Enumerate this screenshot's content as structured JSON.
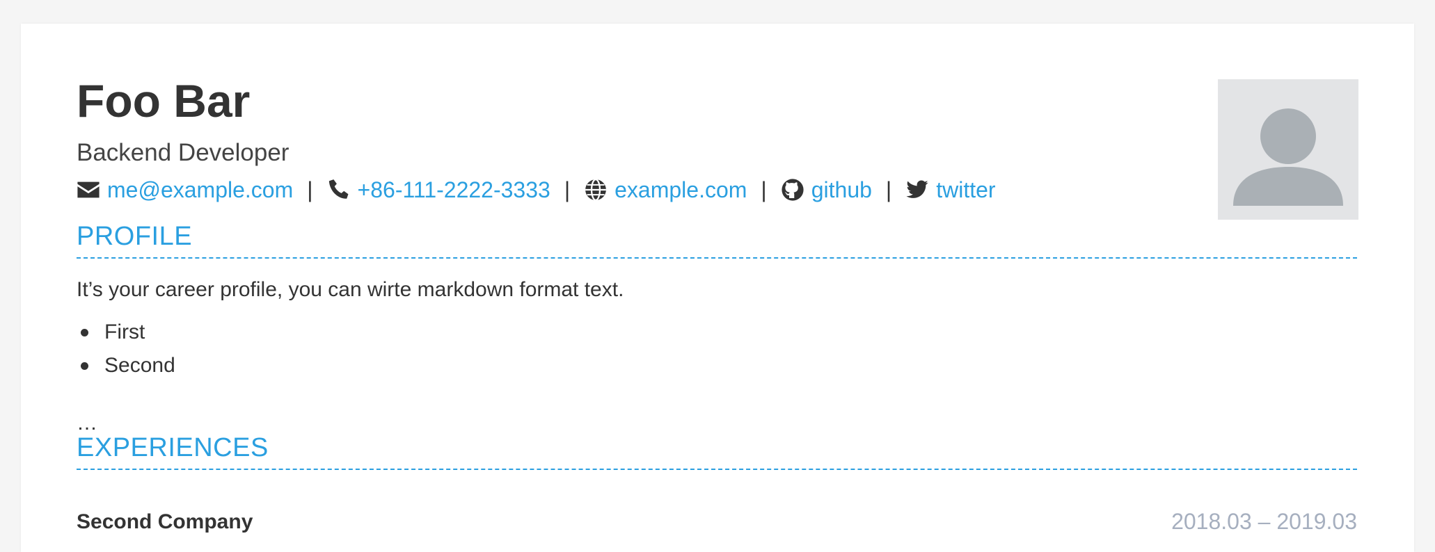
{
  "header": {
    "name": "Foo Bar",
    "role": "Backend Developer",
    "avatar_icon": "user-avatar-icon"
  },
  "contacts": {
    "email": {
      "label": "me@example.com",
      "icon": "envelope-icon"
    },
    "phone": {
      "label": "+86-111-2222-3333",
      "icon": "phone-icon"
    },
    "website": {
      "label": "example.com",
      "icon": "globe-icon"
    },
    "github": {
      "label": "github",
      "icon": "github-icon"
    },
    "twitter": {
      "label": "twitter",
      "icon": "twitter-icon"
    },
    "separator": "|"
  },
  "profile": {
    "title": "PROFILE",
    "text": "It’s your career profile, you can wirte markdown format text.",
    "items": [
      "First",
      "Second"
    ],
    "ellipsis": "…"
  },
  "experiences": {
    "title": "EXPERIENCES",
    "jobs": [
      {
        "company": "Second Company",
        "period": "2018.03 – 2019.03"
      }
    ]
  },
  "colors": {
    "accent": "#2a9fe0",
    "text": "#333333",
    "muted": "#a6afbf",
    "avatar_bg": "#e3e4e6",
    "avatar_fg": "#aab0b5"
  }
}
